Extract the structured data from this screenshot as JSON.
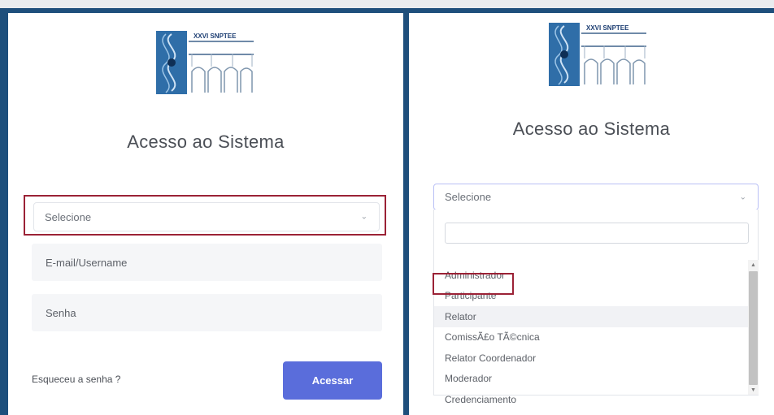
{
  "logo": {
    "text": "XXVI SNPTEE"
  },
  "left": {
    "title": "Acesso ao Sistema",
    "select": {
      "value": "Selecione"
    },
    "email": {
      "placeholder": "E-mail/Username"
    },
    "password": {
      "placeholder": "Senha"
    },
    "forgot": "Esqueceu a senha ?",
    "submit": "Acessar"
  },
  "right": {
    "title": "Acesso ao Sistema",
    "select": {
      "value": "Selecione"
    },
    "options": [
      "Administrador",
      "Participante",
      "Relator",
      "ComissÃ£o TÃ©cnica",
      "Relator Coordenador",
      "Moderador",
      "Credenciamento"
    ]
  },
  "colors": {
    "frame": "#1e4f7c",
    "button": "#5a6ddb",
    "highlight": "#9b2236"
  },
  "icons": {
    "select_arrow": "chevron-down-icon",
    "scroll_up": "scroll-up-icon",
    "scroll_down": "scroll-down-icon"
  }
}
